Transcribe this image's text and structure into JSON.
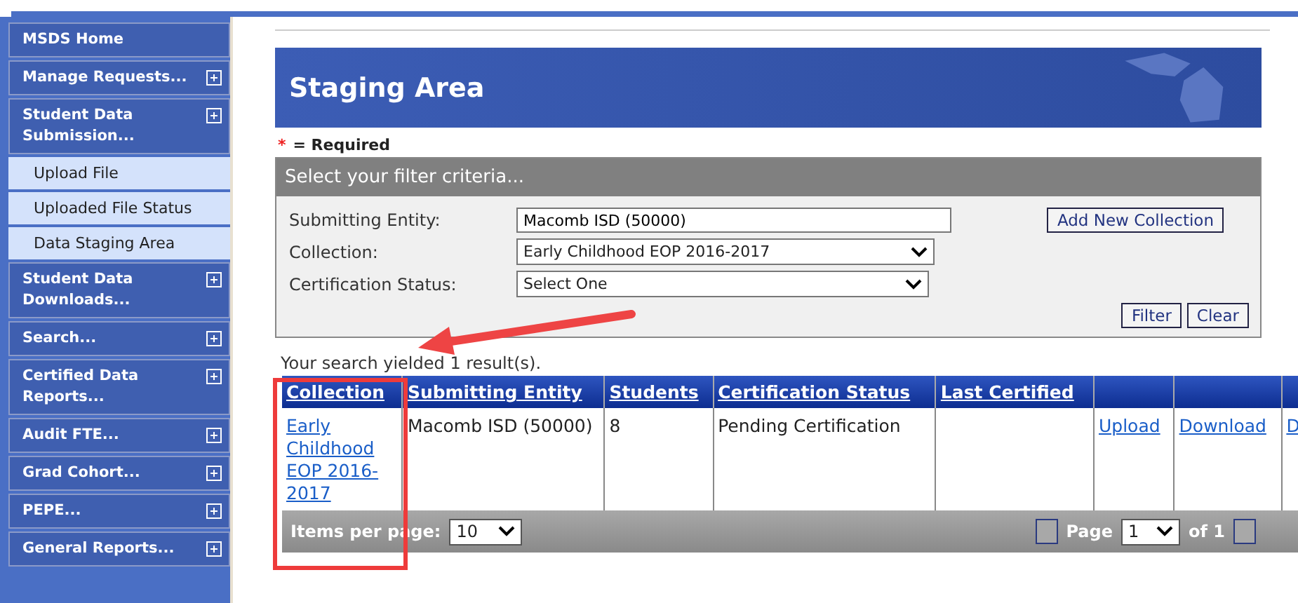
{
  "sidebar": {
    "items": [
      {
        "label": "MSDS Home",
        "expandable": false
      },
      {
        "label": "Manage Requests...",
        "expandable": true
      },
      {
        "label": "Student Data Submission...",
        "expandable": true,
        "children": [
          {
            "label": "Upload File"
          },
          {
            "label": "Uploaded File Status"
          },
          {
            "label": "Data Staging Area"
          }
        ]
      },
      {
        "label": "Student Data Downloads...",
        "expandable": true
      },
      {
        "label": "Search...",
        "expandable": true
      },
      {
        "label": "Certified Data Reports...",
        "expandable": true
      },
      {
        "label": "Audit FTE...",
        "expandable": true
      },
      {
        "label": "Grad Cohort...",
        "expandable": true
      },
      {
        "label": "PEPE...",
        "expandable": true
      },
      {
        "label": "General Reports...",
        "expandable": true
      }
    ]
  },
  "page_title": "Staging Area",
  "required_note": {
    "mark": "*",
    "text": "= Required"
  },
  "filter": {
    "title": "Select your filter criteria...",
    "fields": [
      {
        "kind": "text",
        "label": "Submitting Entity:",
        "value": "Macomb ISD (50000)"
      },
      {
        "kind": "select",
        "label": "Collection:",
        "value": "Early Childhood EOP 2016-2017"
      },
      {
        "kind": "select",
        "label": "Certification Status:",
        "value": "Select One"
      }
    ],
    "add_button": "Add New Collection",
    "buttons": [
      "Filter",
      "Clear"
    ]
  },
  "result_text": "Your search yielded 1 result(s).",
  "table": {
    "columns": [
      "Collection",
      "Submitting Entity",
      "Students",
      "Certification Status",
      "Last Certified",
      "",
      ""
    ],
    "rows": [
      {
        "collection": "Early Childhood EOP 2016-2017",
        "entity": "Macomb ISD (50000)",
        "students": "8",
        "status": "Pending Certification",
        "last_certified": "",
        "links": [
          "Upload",
          "Download",
          "D"
        ]
      }
    ]
  },
  "pager": {
    "items_label": "Items per page:",
    "items_value": "10",
    "page_label": "Page",
    "page_value": "1",
    "of_label": "of 1"
  }
}
